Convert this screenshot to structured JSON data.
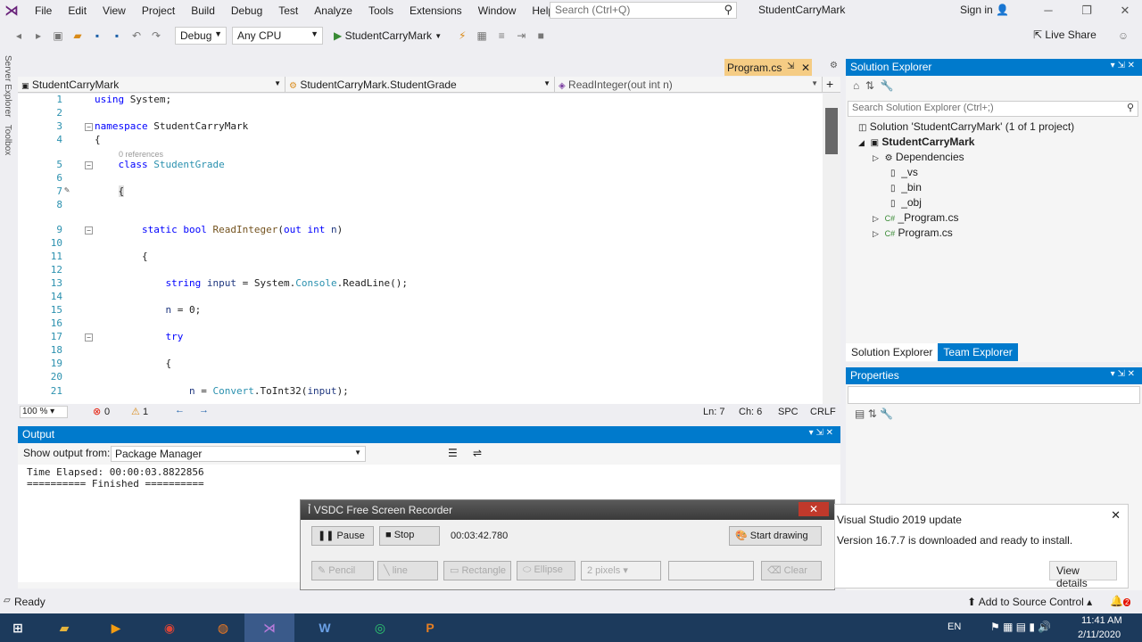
{
  "menu": {
    "items": [
      "File",
      "Edit",
      "View",
      "Project",
      "Build",
      "Debug",
      "Test",
      "Analyze",
      "Tools",
      "Extensions",
      "Window",
      "Help"
    ],
    "search_placeholder": "Search (Ctrl+Q)",
    "solution_name": "StudentCarryMark",
    "sign_in": "Sign in"
  },
  "toolbar": {
    "config": "Debug",
    "platform": "Any CPU",
    "run_target": "StudentCarryMark",
    "live_share": "Live Share"
  },
  "editor": {
    "tab": "Program.cs",
    "nav": [
      "StudentCarryMark",
      "StudentCarryMark.StudentGrade",
      "ReadInteger(out int n)"
    ],
    "lines": [
      {
        "n": "1",
        "t": "using System;"
      },
      {
        "n": "2",
        "t": ""
      },
      {
        "n": "3",
        "t": "namespace StudentCarryMark"
      },
      {
        "n": "4",
        "t": "{"
      },
      {
        "n": "5",
        "t": "    class StudentGrade"
      },
      {
        "n": "6",
        "t": ""
      },
      {
        "n": "7",
        "t": "    {"
      },
      {
        "n": "8",
        "t": ""
      },
      {
        "n": "9",
        "t": "        static bool ReadInteger(out int n)"
      },
      {
        "n": "10",
        "t": ""
      },
      {
        "n": "11",
        "t": "        {"
      },
      {
        "n": "12",
        "t": ""
      },
      {
        "n": "13",
        "t": "            string input = System.Console.ReadLine();"
      },
      {
        "n": "14",
        "t": ""
      },
      {
        "n": "15",
        "t": "            n = 0;"
      },
      {
        "n": "16",
        "t": ""
      },
      {
        "n": "17",
        "t": "            try"
      },
      {
        "n": "18",
        "t": ""
      },
      {
        "n": "19",
        "t": "            {"
      },
      {
        "n": "20",
        "t": ""
      },
      {
        "n": "21",
        "t": "                n = Convert.ToInt32(input);"
      }
    ],
    "references": "0 references",
    "zoom": "100 %",
    "errors": "0",
    "warnings": "1",
    "ln": "Ln: 7",
    "ch": "Ch: 6",
    "spc": "SPC",
    "crlf": "CRLF"
  },
  "solution_explorer": {
    "title": "Solution Explorer",
    "search_placeholder": "Search Solution Explorer (Ctrl+;)",
    "items": [
      {
        "label": "Solution 'StudentCarryMark' (1 of 1 project)"
      },
      {
        "label": "StudentCarryMark"
      },
      {
        "label": "Dependencies"
      },
      {
        "label": "_vs"
      },
      {
        "label": "_bin"
      },
      {
        "label": "_obj"
      },
      {
        "label": "_Program.cs"
      },
      {
        "label": "Program.cs"
      }
    ],
    "tabs": [
      "Solution Explorer",
      "Team Explorer"
    ]
  },
  "properties": {
    "title": "Properties"
  },
  "output": {
    "title": "Output",
    "show_from_label": "Show output from:",
    "source": "Package Manager",
    "lines": [
      "Time Elapsed: 00:00:03.8822856",
      "========== Finished =========="
    ]
  },
  "recorder": {
    "title": "VSDC Free Screen Recorder",
    "pause": "Pause",
    "stop": "Stop",
    "time": "00:03:42.780",
    "start_drawing": "Start drawing",
    "pencil": "Pencil",
    "line": "line",
    "rectangle": "Rectangle",
    "ellipse": "Ellipse",
    "pixels": "2 pixels",
    "clear": "Clear"
  },
  "notification": {
    "title": "Visual Studio 2019 update",
    "body": "Version 16.7.7 is downloaded and ready to install.",
    "button": "View details"
  },
  "status": {
    "ready": "Ready",
    "source_control": "Add to Source Control",
    "badge": "2"
  },
  "taskbar": {
    "lang": "EN",
    "time": "11:41 AM",
    "date": "2/11/2020"
  }
}
